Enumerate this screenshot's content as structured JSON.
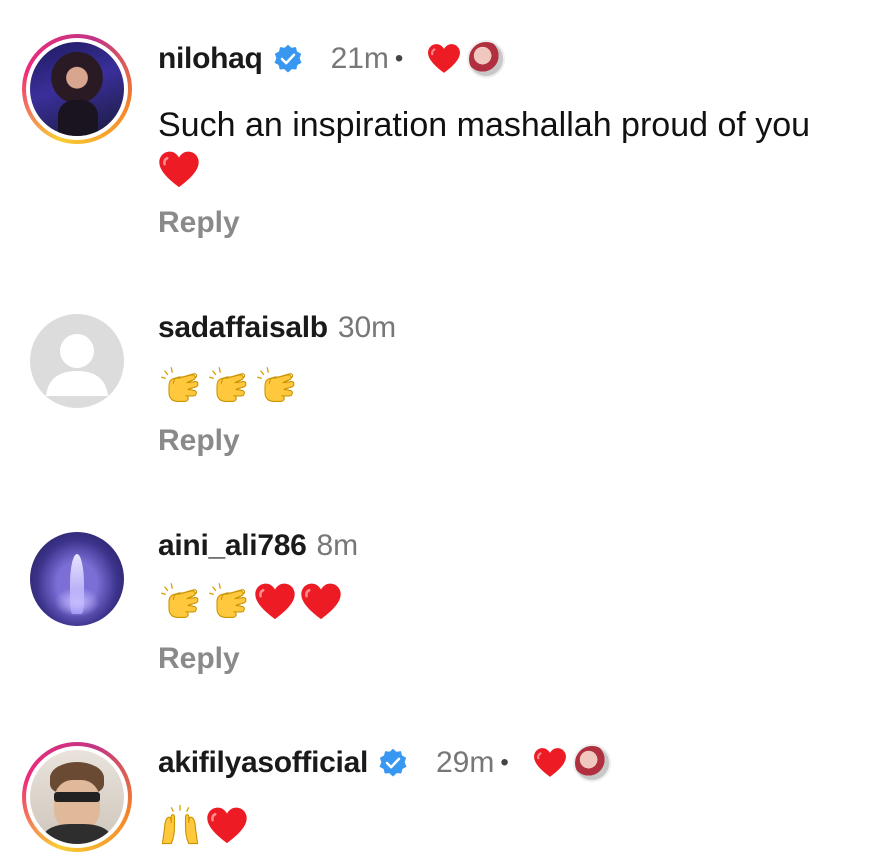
{
  "comments": [
    {
      "username": "nilohaq",
      "verified": true,
      "time": "21m",
      "dot": "•",
      "text": "Such an inspiration mashallah proud of you",
      "reply_label": "Reply"
    },
    {
      "username": "sadaffaisalb",
      "verified": false,
      "time": "30m",
      "reply_label": "Reply"
    },
    {
      "username": "aini_ali786",
      "verified": false,
      "time": "8m",
      "reply_label": "Reply"
    },
    {
      "username": "akifilyasofficial",
      "verified": true,
      "time": "29m",
      "dot": "•"
    }
  ],
  "colors": {
    "verified_blue": "#3897f0",
    "heart_red": "#ed1c24",
    "muted_text": "#8a8a8a",
    "clap_yellow": "#ffc83d"
  },
  "icons": [
    "verified-badge-icon",
    "heart-icon",
    "clapping-hands-icon",
    "raising-hands-icon"
  ]
}
